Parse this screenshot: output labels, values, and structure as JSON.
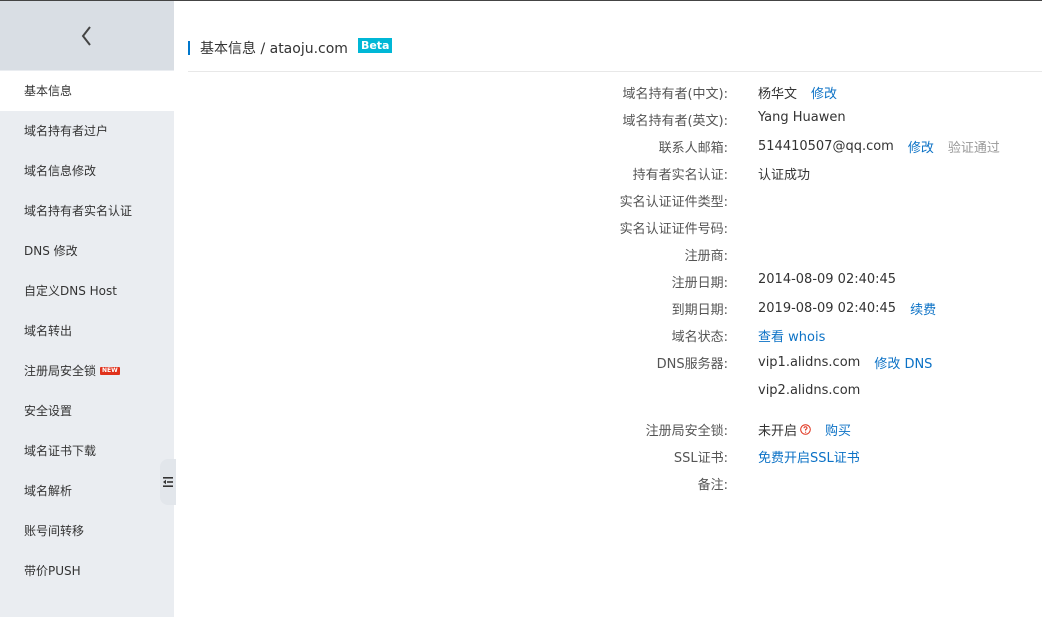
{
  "sidebar": {
    "items": [
      {
        "label": "基本信息"
      },
      {
        "label": "域名持有者过户"
      },
      {
        "label": "域名信息修改"
      },
      {
        "label": "域名持有者实名认证"
      },
      {
        "label": "DNS 修改"
      },
      {
        "label": "自定义DNS Host"
      },
      {
        "label": "域名转出"
      },
      {
        "label": "注册局安全锁",
        "badge": "NEW"
      },
      {
        "label": "安全设置"
      },
      {
        "label": "域名证书下载"
      },
      {
        "label": "域名解析"
      },
      {
        "label": "账号间转移"
      },
      {
        "label": "带价PUSH"
      }
    ]
  },
  "header": {
    "title": "基本信息 / ataoju.com",
    "badge": "Beta"
  },
  "info": {
    "owner_cn": {
      "label": "域名持有者(中文):",
      "value": "杨华文",
      "action": "修改"
    },
    "owner_en": {
      "label": "域名持有者(英文):",
      "value": "Yang Huawen"
    },
    "email": {
      "label": "联系人邮箱:",
      "value": "514410507@qq.com",
      "action": "修改",
      "status": "验证通过"
    },
    "realname": {
      "label": "持有者实名认证:",
      "value": "认证成功"
    },
    "cert_type": {
      "label": "实名认证证件类型:"
    },
    "cert_no": {
      "label": "实名认证证件号码:"
    },
    "registrar": {
      "label": "注册商:"
    },
    "reg_date": {
      "label": "注册日期:",
      "value": "2014-08-09 02:40:45"
    },
    "exp_date": {
      "label": "到期日期:",
      "value": "2019-08-09 02:40:45",
      "action": "续费"
    },
    "status": {
      "label": "域名状态:",
      "action": "查看 whois"
    },
    "dns": {
      "label": "DNS服务器:",
      "value1": "vip1.alidns.com",
      "action": "修改 DNS",
      "value2": "vip2.alidns.com"
    },
    "lock": {
      "label": "注册局安全锁:",
      "value": "未开启",
      "action": "购买"
    },
    "ssl": {
      "label": "SSL证书:",
      "action": "免费开启SSL证书"
    },
    "remark": {
      "label": "备注:"
    }
  },
  "colors": {
    "link": "#0c72c6",
    "accent": "#0077cc",
    "beta": "#00b7d6",
    "new_badge": "#e0321c"
  }
}
